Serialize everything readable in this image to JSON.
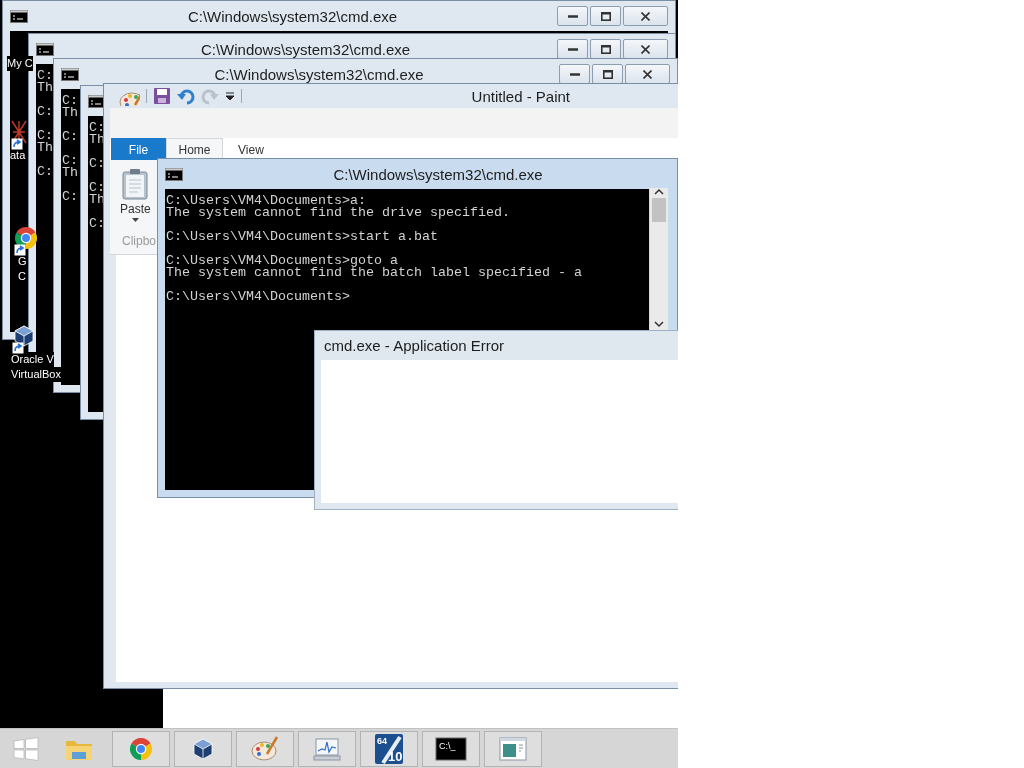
{
  "desktop_icons": [
    {
      "kind": "label-only",
      "shortcut": false,
      "label_lines": [
        "My C"
      ]
    },
    {
      "kind": "broken",
      "shortcut": true,
      "label_lines": [
        "ata"
      ]
    },
    {
      "kind": "browser",
      "shortcut": true,
      "label_lines": [
        "G",
        "C"
      ]
    },
    {
      "kind": "cube",
      "shortcut": true,
      "label_lines": [
        "Oracle V",
        "VirtualBox"
      ]
    }
  ],
  "background_windows": [
    {
      "title": "C:\\Windows\\system32\\cmd.exe"
    },
    {
      "title": "C:\\Windows\\system32\\cmd.exe",
      "console_groups": [
        [
          "C:",
          "Th"
        ],
        [
          "C:"
        ],
        [
          "C:",
          "Th"
        ],
        [
          "C:"
        ]
      ]
    },
    {
      "title": "C:\\Windows\\system32\\cmd.exe",
      "console_groups": [
        [
          "C:",
          "Th"
        ],
        [
          "C:"
        ],
        [
          "C:",
          "Th"
        ],
        [
          "C:"
        ]
      ]
    },
    {
      "console_groups": [
        [
          "C:",
          "Th"
        ],
        [
          "C:"
        ],
        [
          "C:",
          "Th"
        ],
        [
          "C:"
        ]
      ]
    }
  ],
  "paint": {
    "title": "Untitled - Paint",
    "tabs": [
      {
        "label": "File",
        "kind": "menu",
        "selected": false
      },
      {
        "label": "Home",
        "kind": "tab",
        "selected": true
      },
      {
        "label": "View",
        "kind": "tab",
        "selected": false
      }
    ],
    "ribbon": {
      "paste_label": "Paste",
      "group_label": "Clipbo"
    }
  },
  "console": {
    "title": "C:\\Windows\\system32\\cmd.exe",
    "output_groups": [
      [
        "C:\\Users\\VM4\\Documents>a:",
        "The system cannot find the drive specified."
      ],
      [
        "C:\\Users\\VM4\\Documents>start a.bat"
      ],
      [
        "C:\\Users\\VM4\\Documents>goto a",
        "The system cannot find the batch label specified - a"
      ],
      [
        "C:\\Users\\VM4\\Documents>"
      ]
    ]
  },
  "error_dialog": {
    "title": "cmd.exe - Application Error"
  },
  "taskbar": {
    "items": [
      {
        "kind": "start",
        "running": false
      },
      {
        "kind": "explorer",
        "running": false
      },
      {
        "kind": "browser",
        "running": true
      },
      {
        "kind": "cube",
        "running": true
      },
      {
        "kind": "paint",
        "running": true
      },
      {
        "kind": "monitor",
        "running": true
      },
      {
        "kind": "benchmark",
        "running": true,
        "texts": [
          "64",
          "10"
        ]
      },
      {
        "kind": "terminal",
        "running": true,
        "texts": [
          "C:\\_"
        ]
      },
      {
        "kind": "window",
        "running": true
      }
    ]
  }
}
